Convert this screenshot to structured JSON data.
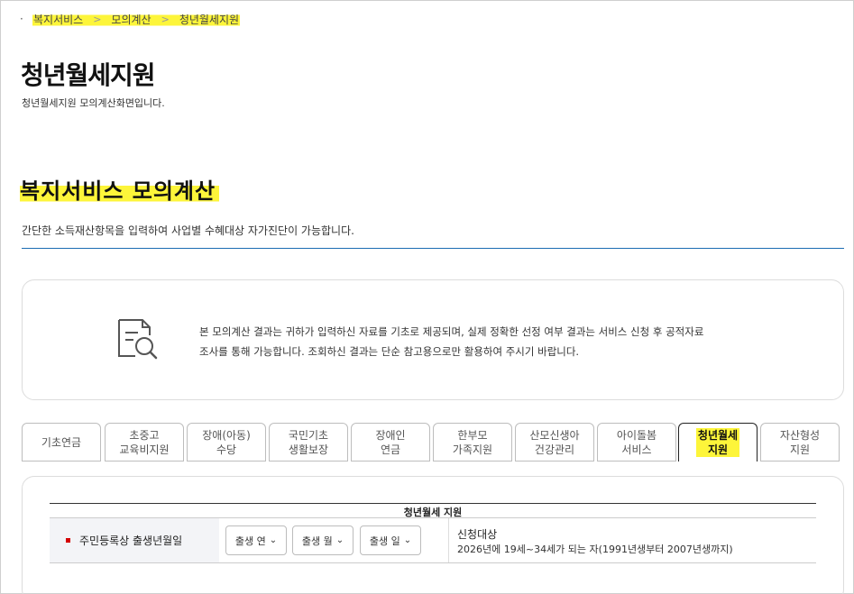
{
  "breadcrumb": {
    "bullet": "·",
    "items": [
      "복지서비스",
      "모의계산",
      "청년월세지원"
    ],
    "separator": ">"
  },
  "page": {
    "title": "청년월세지원",
    "subtitle": "청년월세지원 모의계산화면입니다."
  },
  "section": {
    "title": "복지서비스 모의계산",
    "description": "간단한 소득재산항목을 입력하여 사업별 수혜대상 자가진단이 가능합니다."
  },
  "notice": {
    "icon": "document-search-icon",
    "line1": "본 모의계산 결과는 귀하가 입력하신 자료를 기초로 제공되며, 실제 정확한 선정 여부 결과는 서비스 신청 후 공적자료",
    "line2": "조사를 통해 가능합니다. 조회하신 결과는 단순 참고용으로만 활용하여 주시기 바랍니다."
  },
  "tabs": [
    {
      "label": "기초연금",
      "active": false
    },
    {
      "label": "초중고\n교육비지원",
      "active": false
    },
    {
      "label": "장애(아동)\n수당",
      "active": false
    },
    {
      "label": "국민기초\n생활보장",
      "active": false
    },
    {
      "label": "장애인\n연금",
      "active": false
    },
    {
      "label": "한부모\n가족지원",
      "active": false
    },
    {
      "label": "산모신생아\n건강관리",
      "active": false
    },
    {
      "label": "아이돌봄\n서비스",
      "active": false
    },
    {
      "label": "청년월세\n지원",
      "active": true
    },
    {
      "label": "자산형성\n지원",
      "active": false
    }
  ],
  "form": {
    "caption": "청년월세 지원",
    "row_label": "주민등록상 출생년월일",
    "selects": [
      "출생 연",
      "출생 월",
      "출생 일"
    ],
    "info_title": "신청대상",
    "info_desc": "2026년에 19세~34세가 되는 자(1991년생부터 2007년생까지)"
  },
  "colors": {
    "highlight": "#fdf53a",
    "section_line": "#1c6cb3",
    "required_marker": "#d40000"
  }
}
